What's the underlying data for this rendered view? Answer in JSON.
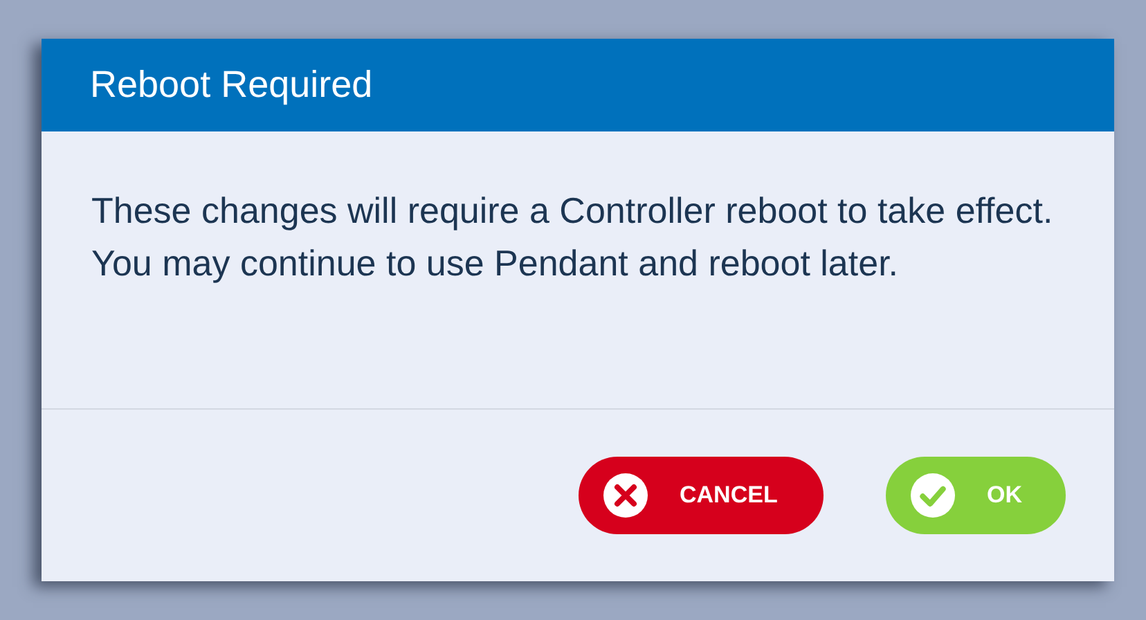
{
  "dialog": {
    "title": "Reboot Required",
    "message": "These changes will require a Controller reboot to take effect. You may continue to use Pendant and reboot later.",
    "buttons": [
      {
        "kind": "cancel",
        "label": "CANCEL"
      },
      {
        "kind": "ok",
        "label": "OK"
      }
    ]
  }
}
